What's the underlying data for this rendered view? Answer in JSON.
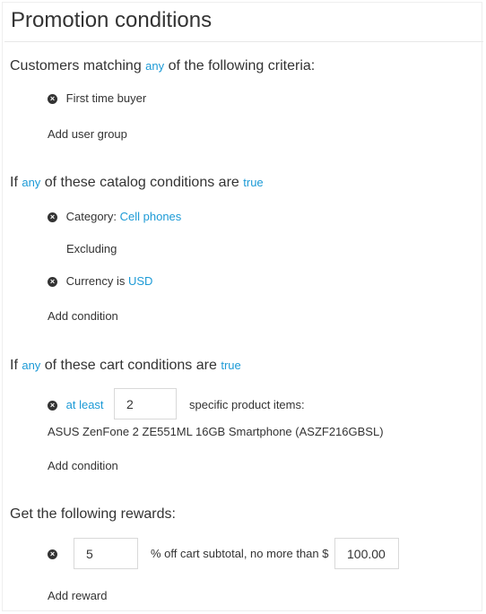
{
  "title": "Promotion conditions",
  "customers": {
    "prefix": "Customers matching",
    "match": "any",
    "suffix": "of the following criteria:",
    "items": [
      {
        "label": "First time buyer"
      }
    ],
    "add_label": "Add user group"
  },
  "catalog": {
    "prefix": "If",
    "match": "any",
    "middle": "of these catalog conditions are",
    "value": "true",
    "category_label": "Category:",
    "category_value": "Cell phones",
    "excluding_label": "Excluding",
    "currency_label": "Currency is",
    "currency_value": "USD",
    "add_label": "Add condition"
  },
  "cart": {
    "prefix": "If",
    "match": "any",
    "middle": "of these cart conditions are",
    "value": "true",
    "quantifier": "at least",
    "quantity": "2",
    "items_label": "specific product items:",
    "product": "ASUS ZenFone 2 ZE551ML 16GB Smartphone (ASZF216GBSL)",
    "add_label": "Add condition"
  },
  "rewards": {
    "heading": "Get the following rewards:",
    "percent": "5",
    "text": "% off cart subtotal, no more than $",
    "max_amount": "100.00",
    "add_label": "Add reward"
  },
  "colors": {
    "link": "#1c9ad6",
    "text": "#333333",
    "border": "#d9d9d9"
  },
  "icons": {
    "remove": "circle-x-icon"
  }
}
